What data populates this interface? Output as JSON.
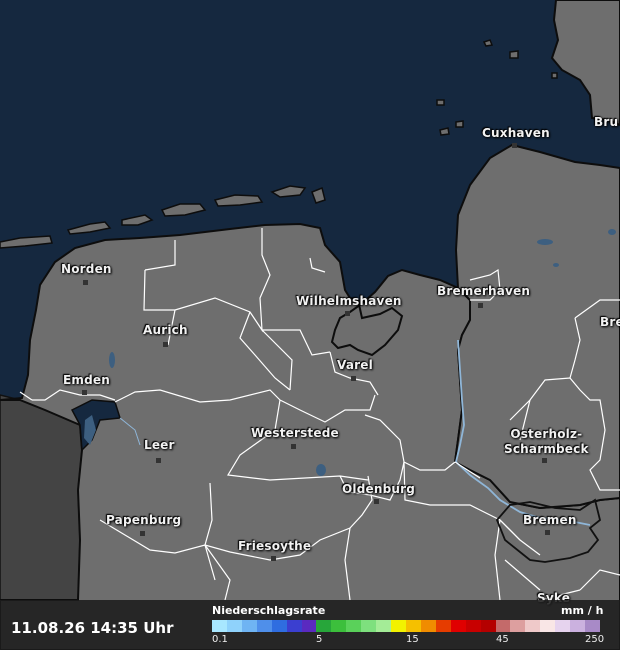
{
  "timestamp": "11.08.26 14:35 Uhr",
  "legend": {
    "title": "Niederschlagsrate",
    "unit": "mm / h",
    "ticks": [
      "0.1",
      "5",
      "15",
      "45",
      "250"
    ],
    "colors": [
      "#a8e7ff",
      "#8fd2fb",
      "#6fb4f3",
      "#4f8fea",
      "#2f6de0",
      "#3b3fd0",
      "#5a2ac0",
      "#27a63a",
      "#3cbf3c",
      "#5ad15a",
      "#7ee07e",
      "#a4ec97",
      "#f2f200",
      "#f5c000",
      "#f08c00",
      "#e63c00",
      "#e00000",
      "#c80000",
      "#b40000",
      "#c46a6a",
      "#dd9f9f",
      "#efc9c9",
      "#f9e6e6",
      "#e6d3ee",
      "#cbb1df",
      "#a88ac7"
    ]
  },
  "cities": [
    {
      "id": "cuxhaven",
      "name": "Cuxhaven"
    },
    {
      "id": "bremerhaven",
      "name": "Bremerhaven"
    },
    {
      "id": "norden",
      "name": "Norden"
    },
    {
      "id": "aurich",
      "name": "Aurich"
    },
    {
      "id": "wilhelmshaven",
      "name": "Wilhelmshaven"
    },
    {
      "id": "emden",
      "name": "Emden"
    },
    {
      "id": "varel",
      "name": "Varel"
    },
    {
      "id": "leer",
      "name": "Leer"
    },
    {
      "id": "westerstede",
      "name": "Westerstede"
    },
    {
      "id": "osterholz",
      "name": "Osterholz-\nScharmbeck"
    },
    {
      "id": "oldenburg",
      "name": "Oldenburg"
    },
    {
      "id": "papenburg",
      "name": "Papenburg"
    },
    {
      "id": "bremen",
      "name": "Bremen"
    },
    {
      "id": "friesoythe",
      "name": "Friesoythe"
    },
    {
      "id": "syke",
      "name": "Syke"
    },
    {
      "id": "brunsbuettel",
      "name": "Bru"
    },
    {
      "id": "bremervoerde",
      "name": "Bre"
    }
  ],
  "colors": {
    "sea": "#15283f",
    "land": "#6e6e6e",
    "netherlands": "#444444",
    "border": "#ffffff",
    "coast": "#0d0d0d",
    "river": "#8fb6d8"
  }
}
